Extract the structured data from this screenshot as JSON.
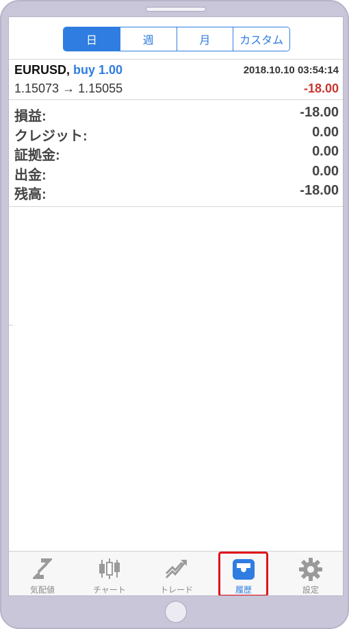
{
  "segment": {
    "tabs": [
      "日",
      "週",
      "月",
      "カスタム"
    ],
    "active_index": 0
  },
  "trade": {
    "symbol": "EURUSD,",
    "side": "buy 1.00",
    "timestamp": "2018.10.10 03:54:14",
    "prices": "1.15073 → 1.15055",
    "profit": "-18.00"
  },
  "summary": [
    {
      "label": "損益:",
      "value": "-18.00"
    },
    {
      "label": "クレジット:",
      "value": "0.00"
    },
    {
      "label": "証拠金:",
      "value": "0.00"
    },
    {
      "label": "出金:",
      "value": "0.00"
    },
    {
      "label": "残高:",
      "value": "-18.00"
    }
  ],
  "nav": [
    {
      "label": "気配値",
      "icon": "quotes-icon"
    },
    {
      "label": "チャート",
      "icon": "chart-icon"
    },
    {
      "label": "トレード",
      "icon": "trade-icon"
    },
    {
      "label": "履歴",
      "icon": "history-icon",
      "active": true
    },
    {
      "label": "設定",
      "icon": "gear-icon"
    }
  ],
  "colors": {
    "accent": "#2f7de1",
    "loss": "#c8372d",
    "highlight": "#e0131c"
  }
}
